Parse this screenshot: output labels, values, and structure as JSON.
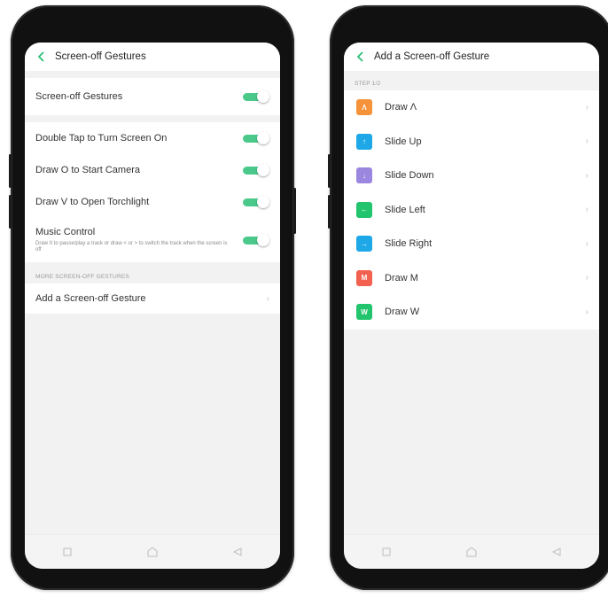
{
  "left_screen": {
    "title": "Screen-off Gestures",
    "master_toggle": {
      "label": "Screen-off Gestures",
      "on": true
    },
    "toggles": [
      {
        "label": "Double Tap to Turn Screen On",
        "on": true
      },
      {
        "label": "Draw O to Start Camera",
        "on": true
      },
      {
        "label": "Draw V to Open Torchlight",
        "on": true
      }
    ],
    "music_control": {
      "label": "Music Control",
      "description": "Draw II to pause/play a track or draw < or > to switch the track when the screen is off",
      "on": true
    },
    "section_label": "MORE SCREEN-OFF GESTURES",
    "add_gesture_label": "Add a Screen-off Gesture"
  },
  "right_screen": {
    "title": "Add a Screen-off Gesture",
    "step_label": "STEP 1/2",
    "gestures": [
      {
        "label": "Draw Λ",
        "icon": "caret-up-icon",
        "glyph": "Λ",
        "color": "#f5923a"
      },
      {
        "label": "Slide Up",
        "icon": "arrow-up-icon",
        "glyph": "↑",
        "color": "#1ea8e8"
      },
      {
        "label": "Slide Down",
        "icon": "arrow-down-icon",
        "glyph": "↓",
        "color": "#9b86e0"
      },
      {
        "label": "Slide Left",
        "icon": "arrow-left-icon",
        "glyph": "←",
        "color": "#22c46e"
      },
      {
        "label": "Slide Right",
        "icon": "arrow-right-icon",
        "glyph": "→",
        "color": "#1ea8e8"
      },
      {
        "label": "Draw M",
        "icon": "letter-m-icon",
        "glyph": "M",
        "color": "#f2614f"
      },
      {
        "label": "Draw W",
        "icon": "letter-w-icon",
        "glyph": "W",
        "color": "#22c46e"
      }
    ]
  },
  "colors": {
    "accent": "#2bbf77",
    "background": "#f2f2f2"
  }
}
